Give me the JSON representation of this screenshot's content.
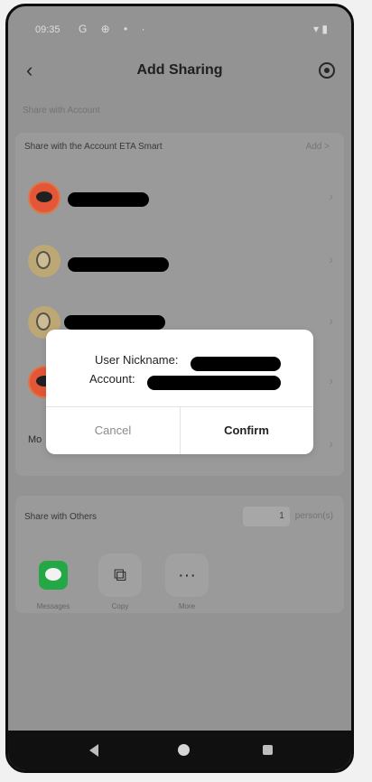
{
  "status_bar": {
    "time": "09:35",
    "icons": [
      "G",
      "⊕",
      "•",
      "·"
    ],
    "right_icons": "▾ ▮"
  },
  "header": {
    "back_icon": "chevron-left",
    "title": "Add Sharing",
    "settings_icon": "settings-icon"
  },
  "share_with_account": {
    "section_label": "Share with Account",
    "row_title": "Share with the Account ETA Smart",
    "add_label": "Add >",
    "accounts": [
      {
        "avatar": "logo"
      },
      {
        "avatar": "face"
      },
      {
        "avatar": "face"
      },
      {
        "avatar": "logo"
      }
    ],
    "more_label": "Mo"
  },
  "share_with_others": {
    "title": "Share with Others",
    "persons_count": "1",
    "persons_suffix": "person(s)",
    "options": [
      {
        "label": "Messages",
        "icon": "message-icon"
      },
      {
        "label": "Copy",
        "icon": "copy-icon"
      },
      {
        "label": "More",
        "icon": "more-icon"
      }
    ]
  },
  "dialog": {
    "nickname_label": "User Nickname:",
    "account_label": "Account:",
    "cancel_label": "Cancel",
    "confirm_label": "Confirm"
  },
  "navbar": {
    "back_icon": "back-triangle-icon",
    "home_icon": "home-circle-icon",
    "recent_icon": "recent-square-icon"
  }
}
